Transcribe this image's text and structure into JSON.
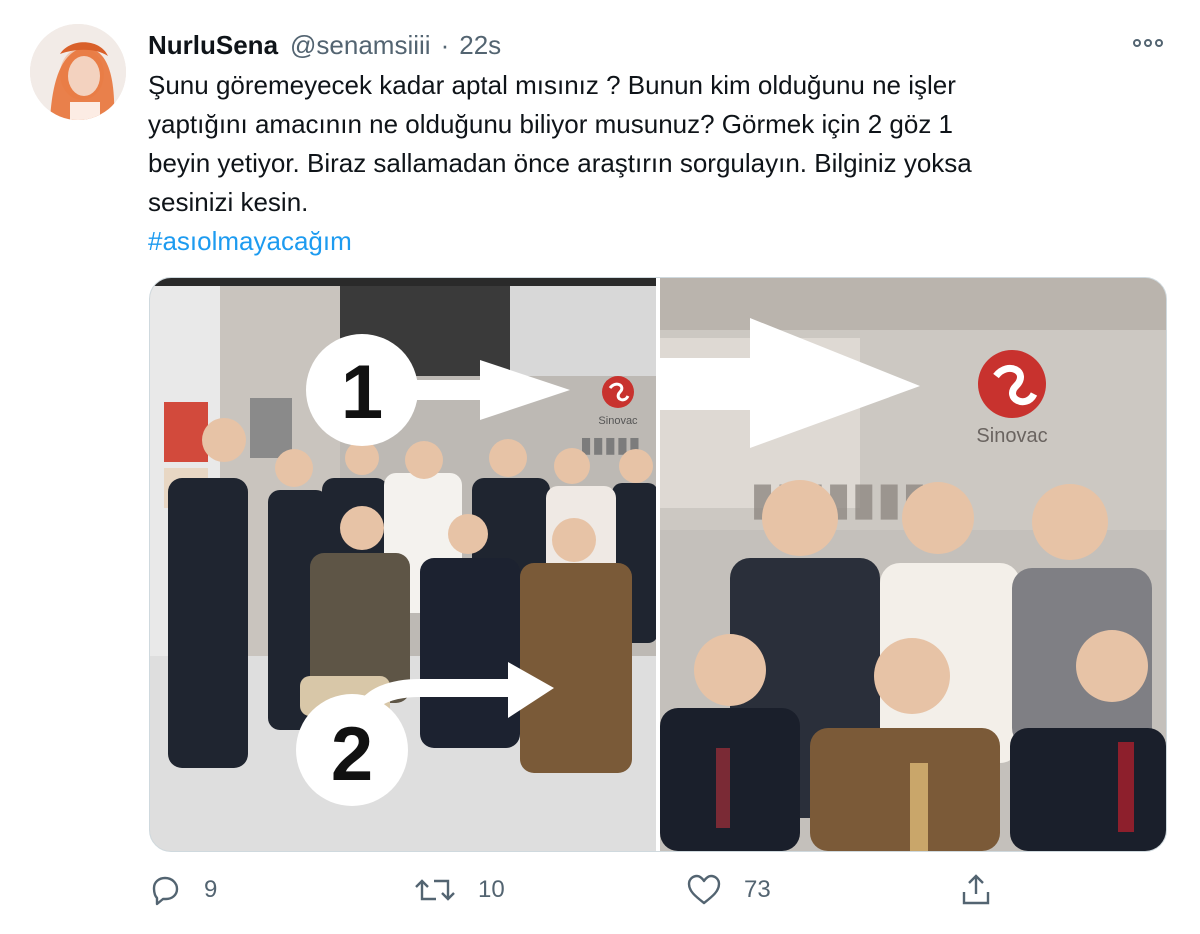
{
  "tweet": {
    "display_name": "NurluSena",
    "handle": "@senamsiiii",
    "separator": "·",
    "time": "22s",
    "text": "Şunu göremeyecek kadar aptal mısınız ? Bunun kim olduğunu ne işler\nyaptığını amacının ne olduğunu biliyor musunuz? Görmek için 2 göz 1\nbeyin yetiyor. Biraz sallamadan önce araştırın sorgulayın. Bilginiz yoksa\nsesinizi kesin.",
    "hashtag": "#asıolmayacağım"
  },
  "media": {
    "annotation_1": "1",
    "annotation_2": "2",
    "logo_text": "Sinovac"
  },
  "actions": {
    "reply_count": "9",
    "retweet_count": "10",
    "like_count": "73"
  },
  "icons": {
    "more": "more-horizontal-icon",
    "reply": "reply-icon",
    "retweet": "retweet-icon",
    "like": "heart-icon",
    "share": "share-icon"
  },
  "colors": {
    "hashtag": "#1d9bf0",
    "muted": "#536471",
    "text": "#0f1419"
  }
}
